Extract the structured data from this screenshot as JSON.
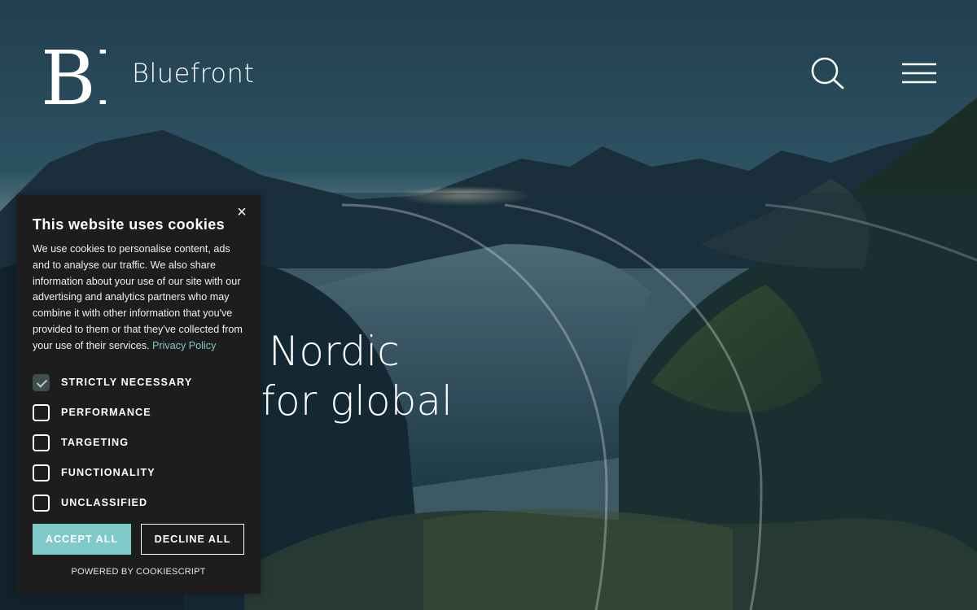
{
  "header": {
    "logo_monogram": "BF",
    "brand_name": "Bluefront"
  },
  "hero": {
    "line1": "Nordic",
    "line2": "rs for global"
  },
  "cookie_banner": {
    "title": "This website uses cookies",
    "close_label": "×",
    "body": "We use cookies to personalise content, ads and to analyse our traffic. We also share information about your use of our site with our advertising and analytics partners who may combine it with other information that you've provided to them or that they've collected from your use of their services.",
    "privacy_link": "Privacy Policy",
    "options": [
      {
        "label": "STRICTLY NECESSARY",
        "checked": true
      },
      {
        "label": "PERFORMANCE",
        "checked": false
      },
      {
        "label": "TARGETING",
        "checked": false
      },
      {
        "label": "FUNCTIONALITY",
        "checked": false
      },
      {
        "label": "UNCLASSIFIED",
        "checked": false
      }
    ],
    "accept_label": "ACCEPT ALL",
    "decline_label": "DECLINE ALL",
    "powered_by": "POWERED BY COOKIESCRIPT"
  },
  "icons": {
    "search": "search-icon",
    "menu": "hamburger-menu-icon",
    "close": "close-icon",
    "check": "checkmark-icon"
  },
  "colors": {
    "accent": "#7fc9c9",
    "banner_bg": "#1d1d1d",
    "checked_box": "#3d4e4c"
  }
}
